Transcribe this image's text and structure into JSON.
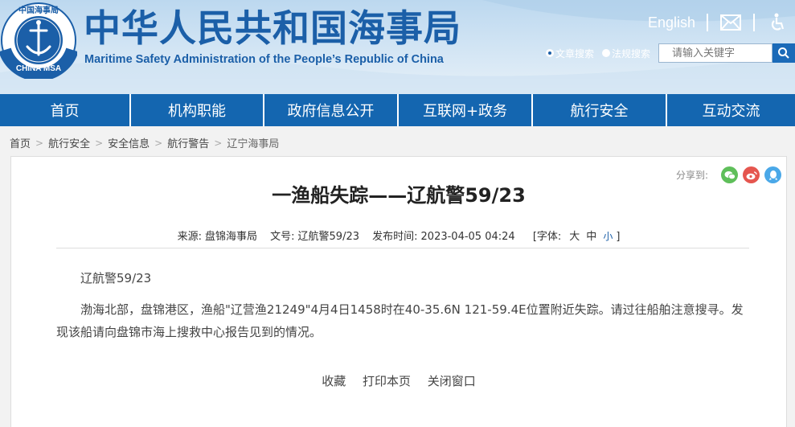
{
  "header": {
    "title": "中华人民共和国海事局",
    "subtitle": "Maritime Safety Administration of the People’s Republic of China",
    "english_link": "English",
    "logo_top_text": "中国海事局",
    "logo_bottom_text": "CHINA MSA"
  },
  "search": {
    "options": [
      "文章搜索",
      "法规搜索"
    ],
    "selected": "文章搜索",
    "placeholder": "请输入关键字"
  },
  "nav": {
    "items": [
      "首页",
      "机构职能",
      "政府信息公开",
      "互联网+政务",
      "航行安全",
      "互动交流"
    ]
  },
  "breadcrumb": [
    "首页",
    "航行安全",
    "安全信息",
    "航行警告",
    "辽宁海事局"
  ],
  "article": {
    "share_label": "分享到:",
    "title": "一渔船失踪——辽航警59/23",
    "source_label": "来源:",
    "source": "盘锦海事局",
    "doc_label": "文号:",
    "doc_no": "辽航警59/23",
    "time_label": "发布时间:",
    "time": "2023-04-05 04:24",
    "font_label": "[字体:",
    "font_large": "大",
    "font_medium": "中",
    "font_small": "小",
    "font_end": "]",
    "para1": "辽航警59/23",
    "para2": "渤海北部，盘锦港区，渔船\"辽营渔21249\"4月4日1458时在40-35.6N 121-59.4E位置附近失踪。请过往船舶注意搜寻。发现该船请向盘锦市海上搜救中心报告见到的情况。"
  },
  "actions": {
    "favorite": "收藏",
    "print": "打印本页",
    "close": "关闭窗口"
  },
  "colors": {
    "brand_blue": "#1b5fa8",
    "nav_blue": "#1466b0",
    "wechat": "#5fbf5a",
    "weibo": "#e5564f",
    "qq": "#4aa8e8"
  }
}
